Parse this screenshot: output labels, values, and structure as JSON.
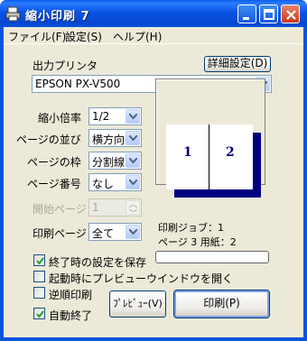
{
  "window": {
    "title": "縮小印刷 7"
  },
  "menu": [
    {
      "label": "ファイル(F)"
    },
    {
      "label": "設定(S)"
    },
    {
      "label": "ヘルプ(H)"
    }
  ],
  "printer": {
    "label": "出力プリンタ",
    "advanced_button": "詳細設定(D)",
    "selected": "EPSON PX-V500"
  },
  "settings": {
    "scale": {
      "label": "縮小倍率",
      "value": "1/2"
    },
    "order": {
      "label": "ページの並び",
      "value": "横方向"
    },
    "frame": {
      "label": "ページの枠",
      "value": "分割線"
    },
    "page_number": {
      "label": "ページ番号",
      "value": "なし"
    },
    "start_page": {
      "label": "開始ページ",
      "value": "1"
    },
    "print_pages": {
      "label": "印刷ページ",
      "value": "全て"
    }
  },
  "preview": {
    "page_left": "1",
    "page_right": "2"
  },
  "status": {
    "job": "印刷ジョブ：1",
    "pages": "ページ 3  用紙：2",
    "progress": 0
  },
  "options": [
    {
      "label": "終了時の設定を保存",
      "checked": true
    },
    {
      "label": "起動時にプレビューウインドウを開く",
      "checked": false
    },
    {
      "label": "逆順印刷",
      "checked": false
    },
    {
      "label": "自動終了",
      "checked": true
    }
  ],
  "buttons": {
    "preview": "ﾌﾟﾚﾋﾞｭｰ(V)",
    "print": "印刷(P)"
  }
}
